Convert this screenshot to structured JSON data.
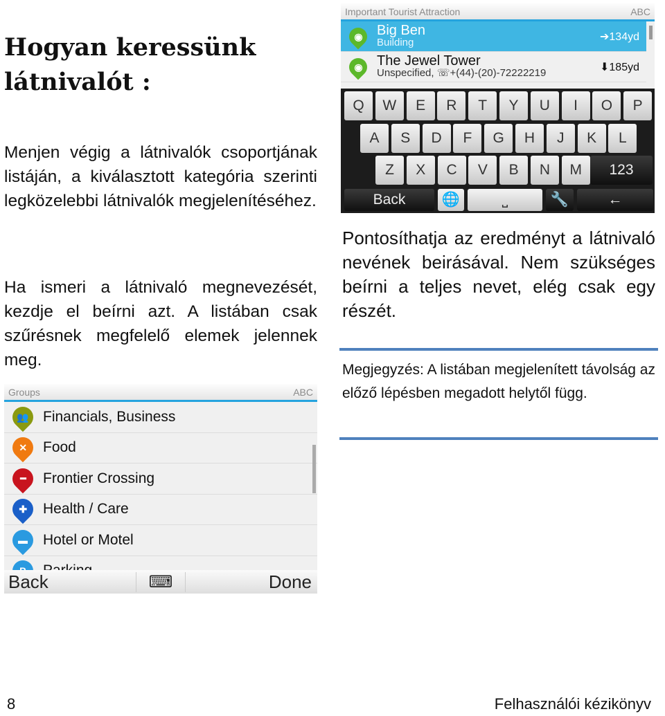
{
  "title": "Hogyan keressünk látnivalót :",
  "left_para1": "Menjen végig a látnivalók csoportjának listáján, a kiválasztott kategória szerinti legközelebbi látnivalók megjelenítéséhez.",
  "left_para2": "Ha ismeri a látnivaló megnevezését, kezdje el beírni azt. A listában csak szűrésnek megfelelő elemek jelennek meg.",
  "groups_screen": {
    "header": "Groups",
    "mode": "ABC",
    "items": [
      {
        "label": "Financials, Business",
        "icon": "people-icon",
        "color": "#8a9a10"
      },
      {
        "label": "Food",
        "icon": "fork-knife-icon",
        "color": "#f07a10"
      },
      {
        "label": "Frontier Crossing",
        "icon": "no-entry-icon",
        "color": "#c8141e"
      },
      {
        "label": "Health / Care",
        "icon": "medical-cross-icon",
        "color": "#1a5fc8"
      },
      {
        "label": "Hotel or Motel",
        "icon": "bed-icon",
        "color": "#2a9ae0"
      },
      {
        "label": "Parking",
        "icon": "parking-icon",
        "color": "#2a9ae0"
      }
    ],
    "back": "Back",
    "done": "Done"
  },
  "attraction_screen": {
    "header": "Important Tourist Attraction",
    "mode": "ABC",
    "items": [
      {
        "name": "Big Ben",
        "sub": "Building",
        "distance": "134yd",
        "dir": "➔",
        "selected": true
      },
      {
        "name": "The Jewel Tower",
        "sub": "Unspecified, ☏+(44)-(20)-72222219",
        "distance": "185yd",
        "dir": "⬇",
        "selected": false
      }
    ],
    "keyboard": {
      "row1": [
        "Q",
        "W",
        "E",
        "R",
        "T",
        "Y",
        "U",
        "I",
        "O",
        "P"
      ],
      "row2": [
        "A",
        "S",
        "D",
        "F",
        "G",
        "H",
        "J",
        "K",
        "L"
      ],
      "row3": [
        "Z",
        "X",
        "C",
        "V",
        "B",
        "N",
        "M"
      ],
      "num": "123",
      "back": "Back",
      "space": "⎵",
      "enter": "←"
    }
  },
  "right_para": "Pontosíthatja az eredményt a látnivaló nevének beirásával. Nem szükséges beírni a teljes nevet, elég csak egy részét.",
  "note": "Megjegyzés: A listában megjelenített távolság az előző lépésben megadott helytől függ.",
  "footer": {
    "page": "8",
    "title": "Felhasználói kézikönyv"
  },
  "accent": "#25a3de"
}
